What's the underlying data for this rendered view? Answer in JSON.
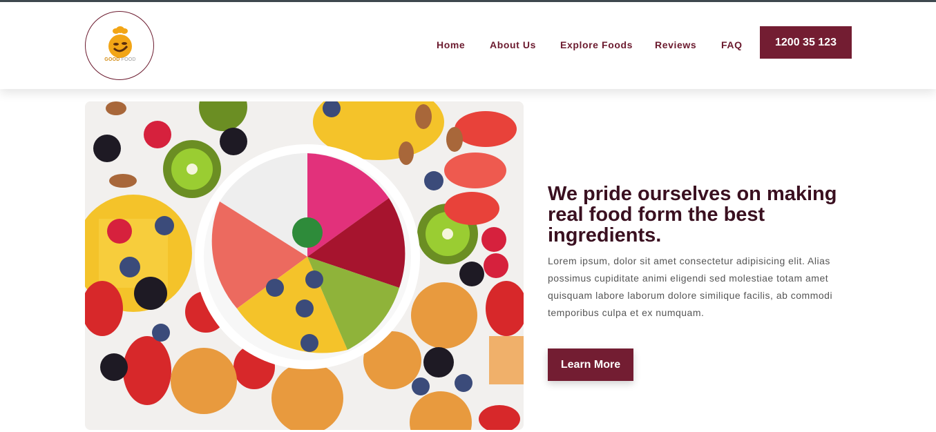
{
  "brand": {
    "logo_text_primary": "GOOD",
    "logo_text_secondary": "FOOD",
    "colors": {
      "accent": "#731d32",
      "logo_orange": "#f2a516"
    }
  },
  "nav": {
    "items": [
      {
        "label": "Home"
      },
      {
        "label": "About Us"
      },
      {
        "label": "Explore Foods"
      },
      {
        "label": "Reviews"
      },
      {
        "label": "FAQ"
      }
    ]
  },
  "header": {
    "phone_label": "1200 35 123"
  },
  "hero": {
    "image_name": "fruit-bowl-photo",
    "headline": "We pride ourselves on making real food form the best ingredients.",
    "body": "Lorem ipsum, dolor sit amet consectetur adipisicing elit. Alias possimus cupiditate animi eligendi sed molestiae totam amet quisquam labore laborum dolore similique facilis, ab commodi temporibus culpa et ex numquam.",
    "cta_label": "Learn More"
  }
}
